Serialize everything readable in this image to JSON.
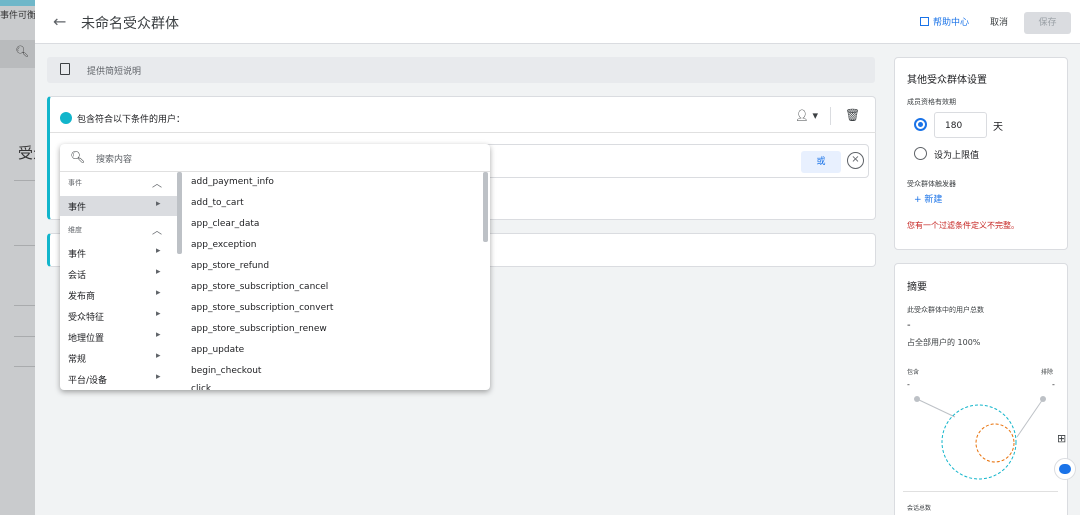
{
  "background": {
    "tab_text": "事件可衡量",
    "search_icon": "search-icon",
    "heading": "受众"
  },
  "header": {
    "back_icon": "back-arrow-icon",
    "title": "未命名受众群体",
    "help_label": "帮助中心",
    "cancel_label": "取消",
    "save_label": "保存"
  },
  "description": {
    "placeholder": "提供简短说明"
  },
  "condition_group": {
    "label": "包含符合以下条件的用户：",
    "or_label": "或"
  },
  "dropdown": {
    "search_placeholder": "搜索内容",
    "sections": [
      {
        "title": "事件",
        "items": [
          "事件"
        ]
      },
      {
        "title": "维度",
        "items": [
          "事件",
          "会话",
          "发布商",
          "受众特征",
          "地理位置",
          "常规",
          "平台/设备"
        ]
      }
    ],
    "events": [
      "add_payment_info",
      "add_to_cart",
      "app_clear_data",
      "app_exception",
      "app_store_refund",
      "app_store_subscription_cancel",
      "app_store_subscription_convert",
      "app_store_subscription_renew",
      "app_update",
      "begin_checkout",
      "click"
    ]
  },
  "settings": {
    "title": "其他受众群体设置",
    "membership_label": "成员资格有效期",
    "days_value": "180",
    "days_unit": "天",
    "max_label": "设为上限值",
    "trigger_label": "受众群体触发器",
    "new_label": "+ 新建",
    "warning": "您有一个过滤条件定义不完整。",
    "warning_color": "#c5221f"
  },
  "summary": {
    "title": "摘要",
    "users_label": "此受众群体中的用户总数",
    "users_value": "-",
    "percent_label": "占全部用户的 100%",
    "include_label": "包含",
    "exclude_label": "排除",
    "include_value": "-",
    "exclude_value": "-",
    "sessions_label": "会话总数"
  },
  "colors": {
    "accent": "#1a73e8",
    "condition": "#12b5cb",
    "exclude_circle": "#e8710a"
  }
}
